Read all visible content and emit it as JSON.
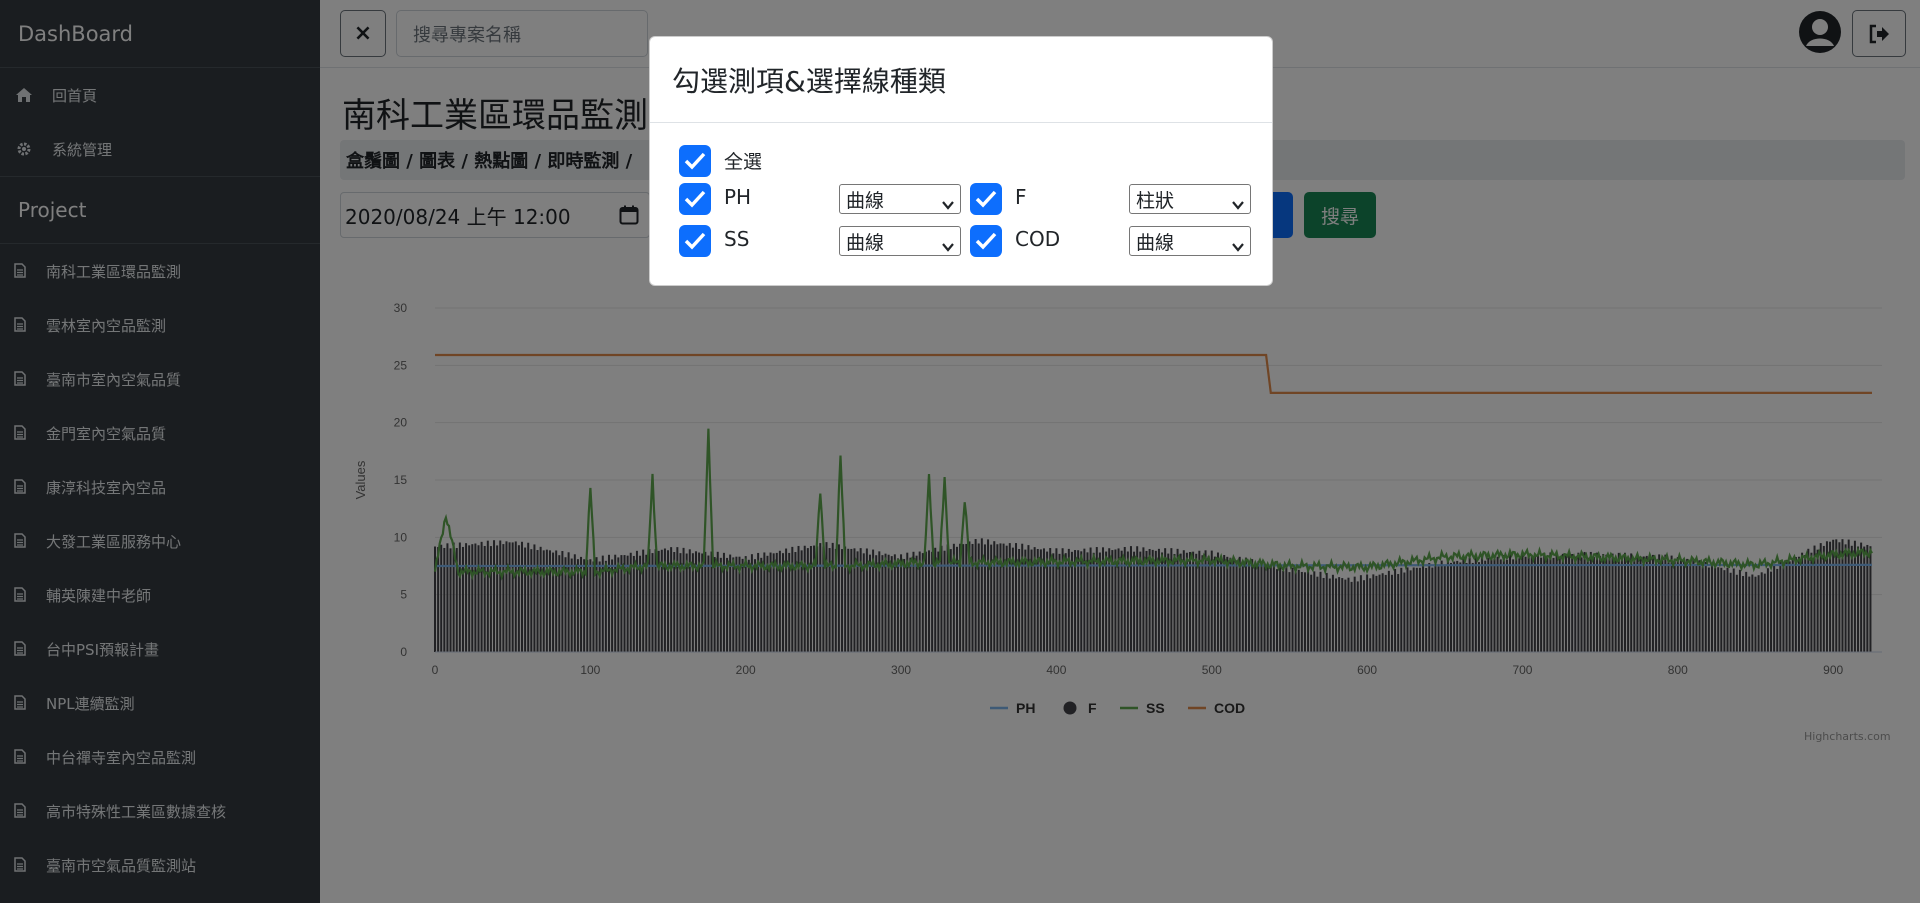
{
  "sidebar": {
    "brand": "DashBoard",
    "nav": [
      {
        "label": "回首頁",
        "icon": "home-icon"
      },
      {
        "label": "系統管理",
        "icon": "gear-icon"
      }
    ],
    "project_heading": "Project",
    "projects": [
      "南科工業區環品監測",
      "雲林室內空品監測",
      "臺南市室內空氣品質",
      "金門室內空氣品質",
      "康淳科技室內空品",
      "大發工業區服務中心",
      "輔英陳建中老師",
      "台中PSI預報計畫",
      "NPL連續監測",
      "中台禪寺室內空品監測",
      "高市特殊性工業區數據查核",
      "臺南市空氣品質監測站"
    ]
  },
  "topbar": {
    "close_label": "×",
    "search_placeholder": "搜尋專案名稱"
  },
  "main": {
    "title": "南科工業區環品監測",
    "breadcrumb": "盒鬚圖 / 圖表 / 熱點圖 / 即時監測 /",
    "date_value": "2020/08/24 上午 12:00",
    "search_button": "搜尋"
  },
  "chart_data": {
    "type": "line",
    "ylabel": "Values",
    "ylim": [
      0,
      30
    ],
    "xlim": [
      0,
      925
    ],
    "yticks": [
      0,
      5,
      10,
      15,
      20,
      25,
      30
    ],
    "xticks": [
      0,
      100,
      200,
      300,
      400,
      500,
      600,
      700,
      800,
      900
    ],
    "series": [
      {
        "name": "PH",
        "kind": "line",
        "color": "#7cb5ec",
        "values": [
          [
            0,
            7.5
          ],
          [
            925,
            7.6
          ]
        ]
      },
      {
        "name": "F",
        "kind": "column",
        "color": "#434348",
        "values": [
          [
            0,
            9.2
          ],
          [
            50,
            9.6
          ],
          [
            100,
            8.0
          ],
          [
            150,
            9.0
          ],
          [
            200,
            8.2
          ],
          [
            250,
            9.4
          ],
          [
            300,
            8.3
          ],
          [
            350,
            9.7
          ],
          [
            400,
            8.8
          ],
          [
            450,
            9.0
          ],
          [
            500,
            8.6
          ],
          [
            550,
            7.2
          ],
          [
            590,
            6.3
          ],
          [
            650,
            7.8
          ],
          [
            700,
            8.4
          ],
          [
            750,
            8.5
          ],
          [
            800,
            8.2
          ],
          [
            850,
            6.6
          ],
          [
            900,
            9.8
          ],
          [
            925,
            9.2
          ]
        ]
      },
      {
        "name": "SS",
        "kind": "line",
        "color": "#5fa84f",
        "values": [
          [
            0,
            7.0
          ],
          [
            7,
            12.0
          ],
          [
            15,
            7.0
          ],
          [
            97,
            7.0
          ],
          [
            100,
            14.3
          ],
          [
            103,
            7.0
          ],
          [
            137,
            7.5
          ],
          [
            140,
            15.4
          ],
          [
            143,
            7.5
          ],
          [
            173,
            7.5
          ],
          [
            176,
            19.5
          ],
          [
            179,
            7.5
          ],
          [
            245,
            7.5
          ],
          [
            248,
            14.2
          ],
          [
            251,
            7.5
          ],
          [
            258,
            7.5
          ],
          [
            261,
            17.1
          ],
          [
            264,
            7.5
          ],
          [
            315,
            7.8
          ],
          [
            318,
            15.3
          ],
          [
            321,
            7.8
          ],
          [
            325,
            7.8
          ],
          [
            328,
            15.2
          ],
          [
            331,
            7.8
          ],
          [
            338,
            7.8
          ],
          [
            341,
            13.3
          ],
          [
            344,
            7.8
          ],
          [
            500,
            8.0
          ],
          [
            550,
            7.5
          ],
          [
            600,
            7.4
          ],
          [
            650,
            8.3
          ],
          [
            700,
            8.5
          ],
          [
            800,
            8.0
          ],
          [
            850,
            7.6
          ],
          [
            900,
            8.5
          ],
          [
            925,
            8.7
          ]
        ]
      },
      {
        "name": "COD",
        "kind": "line",
        "color": "#e08a4a",
        "values": [
          [
            0,
            25.9
          ],
          [
            535,
            25.9
          ],
          [
            538,
            22.6
          ],
          [
            925,
            22.6
          ]
        ]
      }
    ],
    "legend_position": "bottom-center",
    "credits": "Highcharts.com"
  },
  "modal": {
    "title": "勾選測項&選擇線種類",
    "select_all": "全選",
    "items": [
      {
        "label": "PH",
        "type": "曲線"
      },
      {
        "label": "F",
        "type": "柱狀"
      },
      {
        "label": "SS",
        "type": "曲線"
      },
      {
        "label": "COD",
        "type": "曲線"
      }
    ]
  }
}
